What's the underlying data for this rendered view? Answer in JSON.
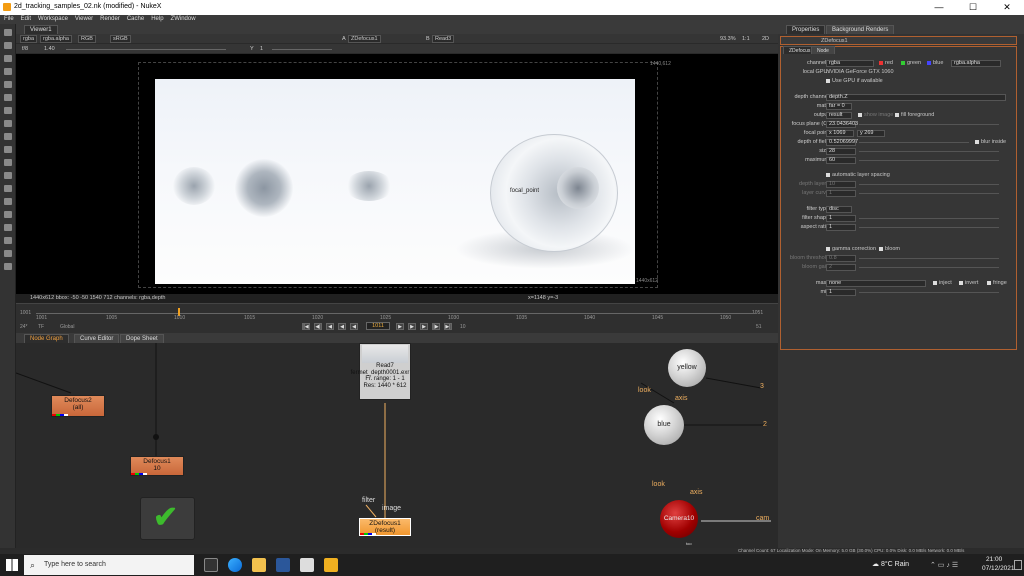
{
  "window": {
    "title": "2d_tracking_samples_02.nk (modified) - NukeX",
    "min": "—",
    "max": "☐",
    "close": "✕"
  },
  "menu": [
    "File",
    "Edit",
    "Workspace",
    "Viewer",
    "Render",
    "Cache",
    "Help",
    "ZWindow"
  ],
  "viewer": {
    "tab": "Viewer1",
    "channels": "rgba",
    "layer": "rgba.alpha",
    "display": "RGB",
    "colorspace": "sRGB",
    "input_a_label": "A",
    "input_a": "ZDefocus1",
    "input_b_label": "B",
    "input_b": "Read3",
    "zoom": "93.3%",
    "ratio": "1:1",
    "mode": "2D",
    "f_label": "f/8",
    "f_value": "1",
    "gain_label": "1.40",
    "y_label": "Y",
    "y_value": "1",
    "res_top": "1440,612",
    "res_bottom": "1440x612",
    "focal_text": "focal_point",
    "status_left": "1440x612  bbox: -50 -50 1540 712  channels: rgba,depth",
    "status_mid": "x=1148 y=-3"
  },
  "timeline": {
    "start": "1001",
    "end": "1051",
    "ticks": [
      "1001",
      "1005",
      "1010",
      "1015",
      "1020",
      "1025",
      "1030",
      "1035",
      "1040",
      "1045",
      "1050"
    ],
    "current": "1011",
    "fps": "24*",
    "tf": "TF",
    "global": "Global",
    "step": "10",
    "end2": "51"
  },
  "nodegraph_tabs": [
    "Node Graph",
    "Curve Editor",
    "Dope Sheet"
  ],
  "nodes": {
    "defocus2": {
      "name": "Defocus2",
      "sub": "(all)"
    },
    "defocus1": {
      "name": "Defocus1",
      "sub": "10"
    },
    "read7": {
      "name": "Read7",
      "line2": "fermet_depth0001.exr",
      "line3": "Fr. range: 1 - 1",
      "line4": "Res: 1440 * 612"
    },
    "zdefocus1": {
      "name": "ZDefocus1",
      "sub": "(result)"
    },
    "yellow": "yellow",
    "blue": "blue",
    "camera": "Camera10",
    "labels": {
      "filter": "filter",
      "image": "image",
      "look1": "look",
      "axis1": "axis",
      "look2": "look",
      "axis2": "axis",
      "cam": "cam",
      "n3": "3",
      "n2": "2",
      "sub_cam": "too"
    }
  },
  "properties": {
    "tabs": [
      "Properties",
      "Background Renders"
    ],
    "node_name": "ZDefocus1",
    "node_tabs": [
      "ZDefocus",
      "Node"
    ],
    "channels_label": "channels",
    "channels_value": "rgba",
    "red": "red",
    "green": "green",
    "blue": "blue",
    "alpha": "rgba.alpha",
    "localgpu_label": "local GPU:",
    "localgpu_value": "NVIDIA GeForce GTX 1060",
    "usegpu": "Use GPU if available",
    "depth_channel_label": "depth channel",
    "depth_channel": "depth.Z",
    "math_label": "math",
    "math": "far = 0",
    "output_label": "output",
    "output": "result",
    "show_image": "show image",
    "fill_fg": "fill foreground",
    "focus_plane_label": "focus plane (C)",
    "focus_plane": "23.0436403",
    "focal_point_label": "focal point",
    "focal_point_x": "x 1069",
    "focal_point_y": "y 269",
    "dof_label": "depth of field",
    "dof": "0.52069997",
    "blur_inside": "blur inside",
    "size_label": "size",
    "size": "28",
    "max_label": "maximum",
    "max": "60",
    "auto_layer": "automatic layer spacing",
    "depth_layers_label": "depth layers",
    "depth_layers": "10",
    "layer_curve_label": "layer curve",
    "layer_curve": "1",
    "filter_type_label": "filter type",
    "filter_type": "disc",
    "filter_shape_label": "filter shape",
    "filter_shape": "1",
    "aspect_label": "aspect ratio",
    "aspect": "1",
    "gamma": "gamma correction",
    "bloom": "bloom",
    "bloom_th_label": "bloom threshold",
    "bloom_th": "0.8",
    "bloom_gain_label": "bloom gain",
    "bloom_gain": "2",
    "mask_label": "mask",
    "mask": "none",
    "inject": "inject",
    "invert": "invert",
    "fringe": "fringe",
    "mix_label": "mix",
    "mix": "1"
  },
  "info_bar": "Channel Count: 67  Localization Mode: On  Memory: 5.0 GB (30.0%)  CPU: 0.0%  Disk: 0.0 MB/s  Network: 0.0 MB/s",
  "taskbar": {
    "search": "Type here to search",
    "weather": "8°C  Rain",
    "time": "21:00",
    "date": "07/12/2021"
  }
}
